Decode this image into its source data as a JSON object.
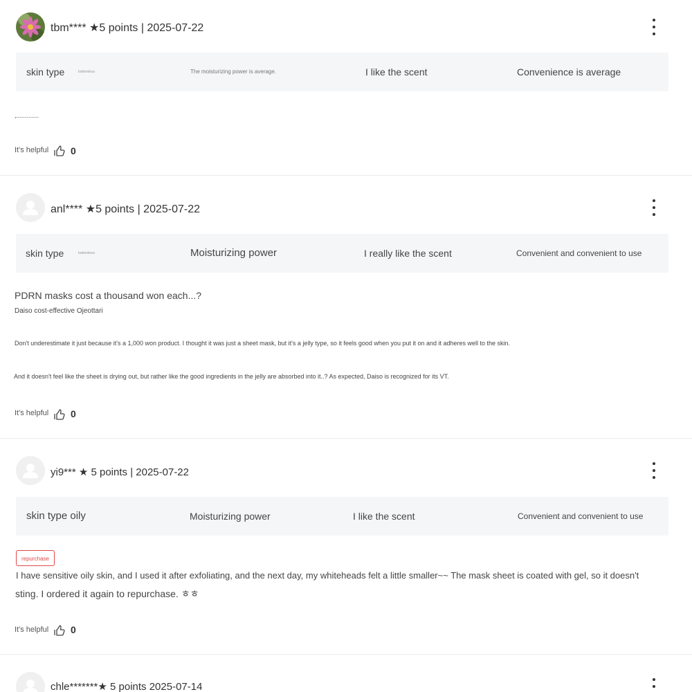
{
  "reviews": [
    {
      "user": "tbm****",
      "rating_text": "★5 points",
      "date": "2025-07-22",
      "attributes": {
        "skin_label": "skin type",
        "skin_value": "bottomless",
        "moisture": "The moisturizing power is average.",
        "scent": "I like the scent",
        "convenience": "Convenience is average"
      },
      "body_lines": [
        ",............."
      ],
      "helpful_label": "It's helpful",
      "helpful_count": "0"
    },
    {
      "user": "anl****",
      "rating_text": "★5 points",
      "date": "2025-07-22",
      "attributes": {
        "skin_label": "skin type",
        "skin_value": "bottomless",
        "moisture": "Moisturizing power",
        "scent": "I really like the scent",
        "convenience": "Convenient and convenient to use"
      },
      "body_lines": [
        "PDRN masks cost a thousand won each...?",
        "Daiso cost-effective Ojeottari",
        "Don't underestimate it just because it's a 1,000 won product. I thought it was just a sheet mask, but it's a jelly type, so it feels good when you put it on and it adheres well to the skin.",
        "And it doesn't feel like the sheet is drying out, but rather like the good ingredients in the jelly are absorbed into it..? As expected, Daiso is recognized for its VT."
      ],
      "helpful_label": "It's helpful",
      "helpful_count": "0"
    },
    {
      "user": "yi9***",
      "rating_text": "★ 5 points",
      "date": "2025-07-22",
      "attributes": {
        "skin_label": "skin type oily",
        "moisture": "Moisturizing power",
        "scent": "I like the scent",
        "convenience": "Convenient and convenient to use"
      },
      "badge": "repurchase",
      "body_lines": [
        "I have sensitive oily skin, and I used it after exfoliating, and the next day, my whiteheads felt a little smaller~~ The mask sheet is coated with gel, so it doesn't",
        "sting. I ordered it again to repurchase. ㅎㅎ"
      ],
      "helpful_label": "It's helpful",
      "helpful_count": "0"
    },
    {
      "user": "chle*******",
      "rating_text": "★ 5 points",
      "date": "2025-07-14"
    }
  ],
  "colors": {
    "attr_bar_bg": "#f5f6f8",
    "badge_red": "#e04848",
    "divider": "#ececec"
  }
}
